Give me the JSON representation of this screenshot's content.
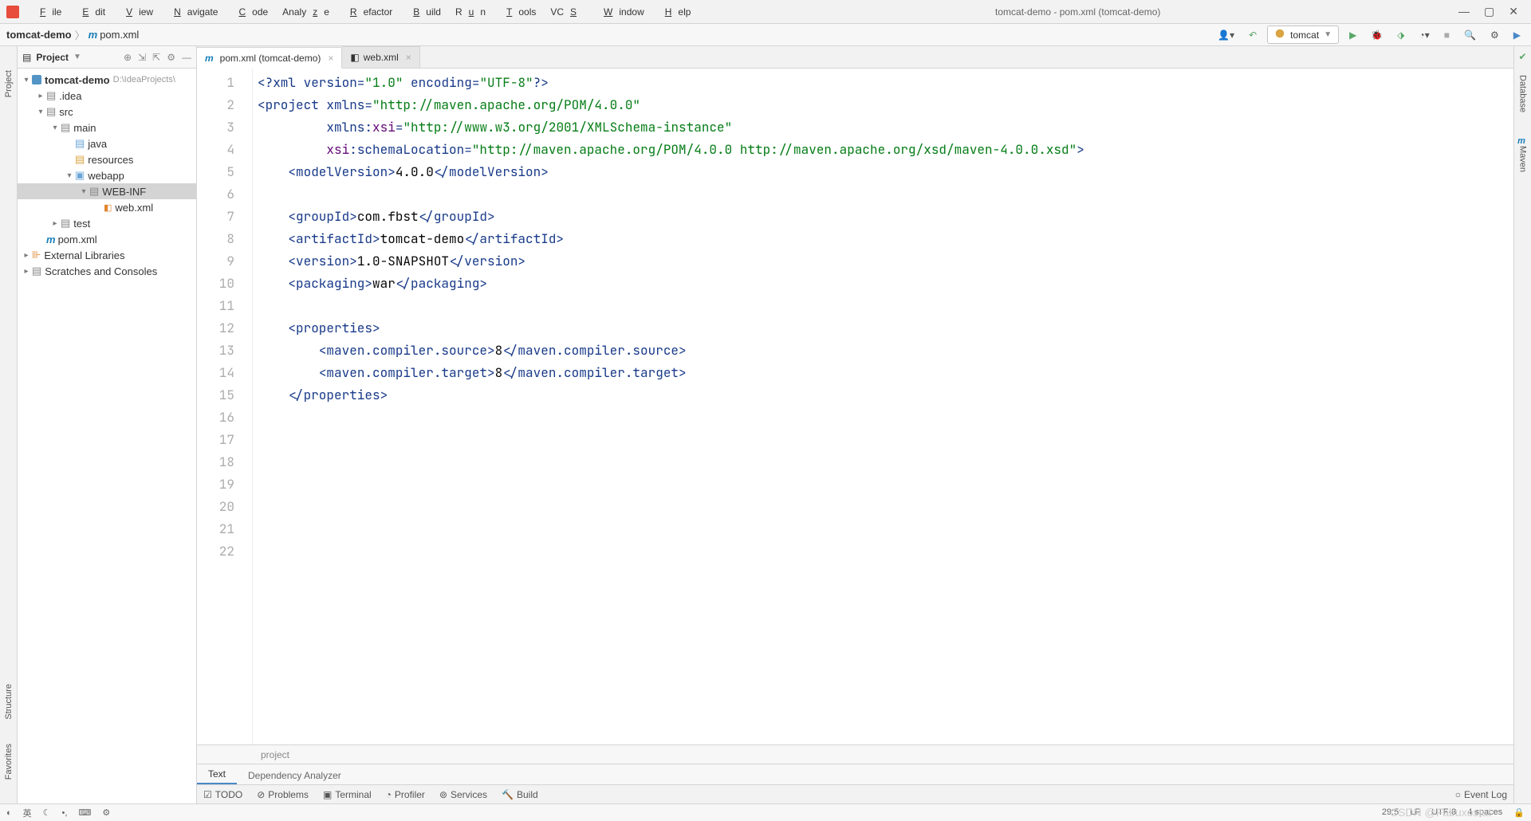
{
  "window": {
    "title": "tomcat-demo - pom.xml (tomcat-demo)"
  },
  "menu": [
    "File",
    "Edit",
    "View",
    "Navigate",
    "Code",
    "Analyze",
    "Refactor",
    "Build",
    "Run",
    "Tools",
    "VCS",
    "Window",
    "Help"
  ],
  "breadcrumb": {
    "project": "tomcat-demo",
    "file": "pom.xml"
  },
  "runConfig": {
    "name": "tomcat"
  },
  "projectPanel": {
    "title": "Project"
  },
  "tree": {
    "root": {
      "name": "tomcat-demo",
      "path": "D:\\IdeaProjects\\"
    },
    "nodes": [
      {
        "indent": 1,
        "arrow": "▸",
        "icon": "folder",
        "label": ".idea"
      },
      {
        "indent": 1,
        "arrow": "▾",
        "icon": "folder",
        "label": "src"
      },
      {
        "indent": 2,
        "arrow": "▾",
        "icon": "folder",
        "label": "main"
      },
      {
        "indent": 3,
        "arrow": "",
        "icon": "folder-blue",
        "label": "java"
      },
      {
        "indent": 3,
        "arrow": "",
        "icon": "folder-res",
        "label": "resources"
      },
      {
        "indent": 3,
        "arrow": "▾",
        "icon": "folder-web",
        "label": "webapp"
      },
      {
        "indent": 4,
        "arrow": "▾",
        "icon": "folder",
        "label": "WEB-INF",
        "selected": true
      },
      {
        "indent": 5,
        "arrow": "",
        "icon": "xml",
        "label": "web.xml"
      },
      {
        "indent": 2,
        "arrow": "▸",
        "icon": "folder",
        "label": "test"
      },
      {
        "indent": 1,
        "arrow": "",
        "icon": "m",
        "label": "pom.xml"
      }
    ],
    "extLibs": "External Libraries",
    "scratches": "Scratches and Consoles"
  },
  "tabs": [
    {
      "icon": "m",
      "label": "pom.xml (tomcat-demo)",
      "active": true
    },
    {
      "icon": "xml",
      "label": "web.xml",
      "active": false
    }
  ],
  "code": {
    "lines": 22,
    "modelVersion": "4.0.0",
    "groupId": "com.fbst",
    "artifactId": "tomcat-demo",
    "version": "1.0-SNAPSHOT",
    "packaging": "war",
    "mvnSource": "8",
    "mvnTarget": "8",
    "xmlDecl": {
      "version": "\"1.0\"",
      "encoding": "\"UTF-8\""
    },
    "ns": {
      "xmlns": "\"http://maven.apache.org/POM/4.0.0\"",
      "xsi": "\"http://www.w3.org/2001/XMLSchema-instance\"",
      "schemaLoc": "\"http://maven.apache.org/POM/4.0.0 http://maven.apache.org/xsd/maven-4.0.0.xsd\""
    }
  },
  "editorFooter": {
    "crumb": "project",
    "tabs": [
      "Text",
      "Dependency Analyzer"
    ]
  },
  "bottomTools": [
    "TODO",
    "Problems",
    "Terminal",
    "Profiler",
    "Services",
    "Build"
  ],
  "eventLog": "Event Log",
  "status": {
    "pos": "29:5",
    "lf": "LF",
    "enc": "UTF-8",
    "indent": "4 spaces"
  },
  "leftGutter": [
    "Project",
    "Structure",
    "Favorites"
  ],
  "rightGutter": [
    "Database",
    "Maven"
  ],
  "watermark": "CSDN @Fabuxostat"
}
